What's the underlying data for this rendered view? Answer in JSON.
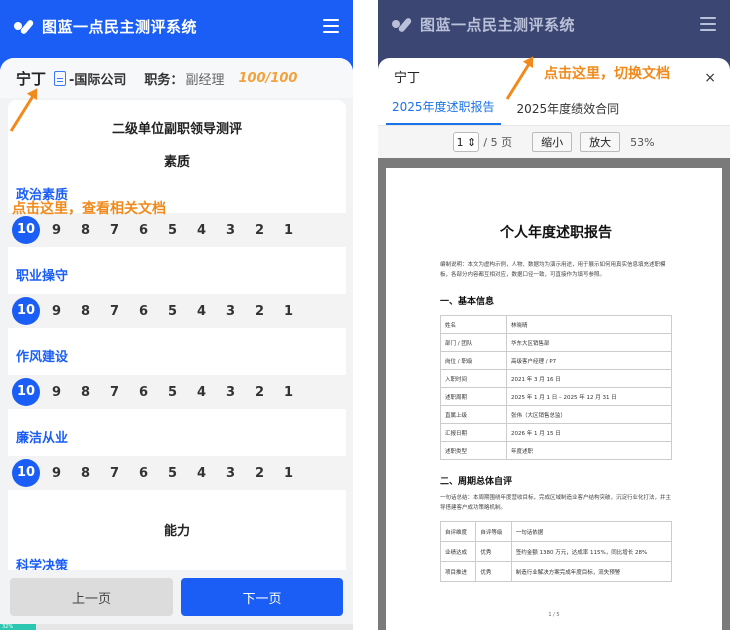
{
  "left": {
    "app_title": "图蓝一点民主测评系统",
    "user": {
      "name": "宁丁",
      "company": "-国际公司",
      "duty_label": "职务：",
      "duty_value": "副经理",
      "score": "100/100"
    },
    "survey_title": "二级单位副职领导测评",
    "section1": "素质",
    "items": [
      {
        "label": "政治素质",
        "selected": "10"
      },
      {
        "label": "职业操守",
        "selected": "10"
      },
      {
        "label": "作风建设",
        "selected": "10"
      },
      {
        "label": "廉洁从业",
        "selected": "10"
      }
    ],
    "scale": [
      "10",
      "9",
      "8",
      "7",
      "6",
      "5",
      "4",
      "3",
      "2",
      "1"
    ],
    "section2": "能力",
    "item5": "科学决策",
    "annotation": "点击这里，查看相关文档",
    "prev_btn": "上一页",
    "next_btn": "下一页",
    "progress_text": "32%",
    "progress": 0.1
  },
  "right": {
    "app_title": "图蓝一点民主测评系统",
    "sheet_name": "宁丁",
    "close": "×",
    "tabs": [
      "2025年度述职报告",
      "2025年度绩效合同"
    ],
    "annotation": "点击这里，切换文档",
    "page_current": "1",
    "page_total": "/ 5 页",
    "zoom_out": "缩小",
    "zoom_in": "放大",
    "zoom_level": "53%",
    "doc": {
      "title": "个人年度述职报告",
      "note": "编制说明：本文为虚构示例，人物、数据均为演示用途，用于展示如何用真实信息填充述职模板，各部分内容都互相对应，数据口径一致，可直接作为填写参照。",
      "h1": "一、基本信息",
      "info": [
        [
          "姓名",
          "林晓晴"
        ],
        [
          "部门 / 团队",
          "华东大区销售部"
        ],
        [
          "岗位 / 职级",
          "高级客户经理 / P7"
        ],
        [
          "入职时间",
          "2021 年 3 月 16 日"
        ],
        [
          "述职周期",
          "2025 年 1 月 1 日 – 2025 年 12 月 31 日"
        ],
        [
          "直属上级",
          "张伟（大区销售总监）"
        ],
        [
          "汇报日期",
          "2026 年 1 月 15 日"
        ],
        [
          "述职类型",
          "年度述职"
        ]
      ],
      "h2": "二、周期总体自评",
      "summary": "一句话总结：本周期围绕年度营收目标，完成区域制造业客户结构突破，沉淀行业化打法，并主导搭建客户成功策略机制。",
      "eval": [
        [
          "自评维度",
          "自评等级",
          "一句话依据"
        ],
        [
          "业绩达成",
          "优秀",
          "签约金额 1380 万元，达成率 115%，同比增长 28%"
        ],
        [
          "项目推进",
          "优秀",
          "制造行业解决方案完成年度目标，流失预警"
        ]
      ],
      "page_footer": "1 / 5"
    }
  }
}
